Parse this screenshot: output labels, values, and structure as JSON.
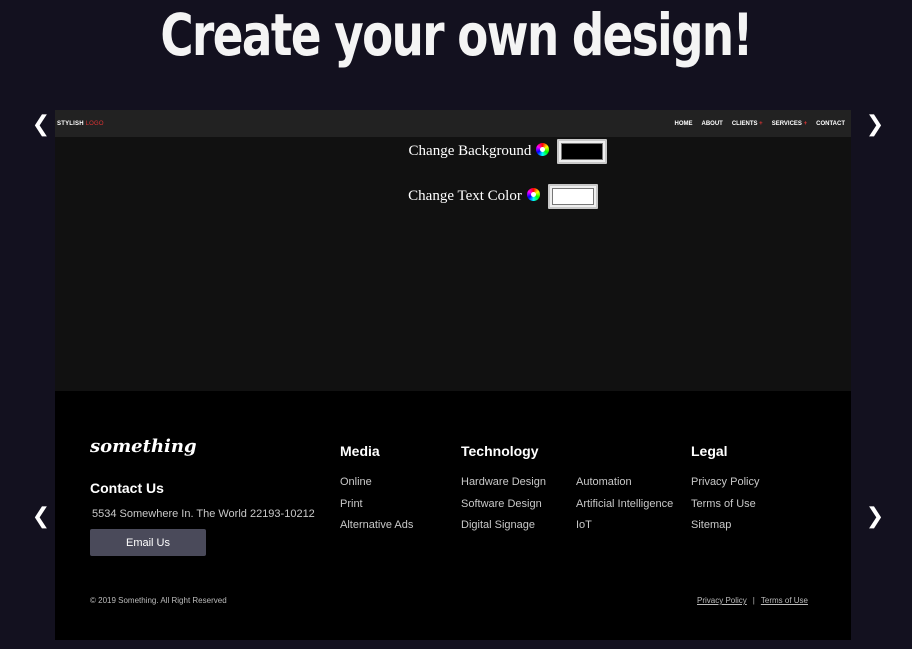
{
  "hero": {
    "title": "Create your own design!"
  },
  "carousel": {
    "prev_glyph": "❮",
    "next_glyph": "❯"
  },
  "navbar": {
    "logo_main": "STYLISH",
    "logo_accent": "LOGO",
    "links": [
      {
        "label": "HOME",
        "has_plus": false
      },
      {
        "label": "ABOUT",
        "has_plus": false
      },
      {
        "label": "CLIENTS",
        "has_plus": true
      },
      {
        "label": "SERVICES",
        "has_plus": true
      },
      {
        "label": "CONTACT",
        "has_plus": false
      }
    ],
    "plus_glyph": "+"
  },
  "controls": {
    "background_label": "Change Background",
    "text_color_label": "Change Text Color",
    "background_value": "#000000",
    "text_color_value": "#ffffff"
  },
  "footer": {
    "brand": "something",
    "contact_heading": "Contact Us",
    "address": "5534 Somewhere In. The World 22193-10212",
    "email_button": "Email Us",
    "media": {
      "heading": "Media",
      "links": [
        "Online",
        "Print",
        "Alternative Ads"
      ]
    },
    "technology": {
      "heading": "Technology",
      "links": [
        "Hardware Design",
        "Software Design",
        "Digital Signage"
      ],
      "links2": [
        "Automation",
        "Artificial Intelligence",
        "IoT"
      ]
    },
    "legal": {
      "heading": "Legal",
      "links": [
        "Privacy Policy",
        "Terms of Use",
        "Sitemap"
      ]
    },
    "copyright": "© 2019 Something. All Right Reserved",
    "bottom_links": [
      "Privacy Policy",
      "Terms of Use"
    ],
    "separator": "|"
  },
  "colors": {
    "page_bg": "#13111f",
    "accent": "#dd3333",
    "footer_bg": "#000000",
    "button_bg": "#4a4a5a"
  }
}
